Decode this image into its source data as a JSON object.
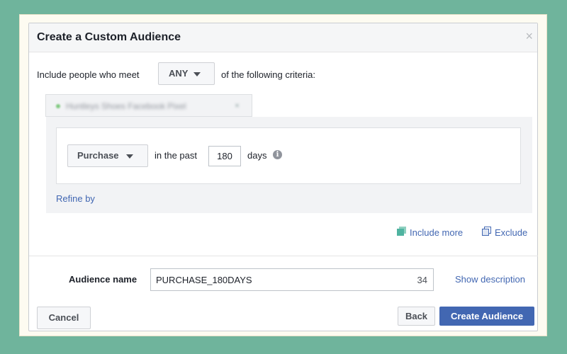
{
  "dialog": {
    "title": "Create a Custom Audience",
    "close_glyph": "×"
  },
  "criteria": {
    "prefix": "Include people who meet",
    "match_value": "ANY",
    "suffix": "of the following criteria:"
  },
  "pixel_chip": {
    "label": "Huntleys Shoes Facebook Pixel",
    "remove_glyph": "×"
  },
  "rule": {
    "event_value": "Purchase",
    "in_the_past_label": "in the past",
    "days_value": "180",
    "days_label": "days",
    "info_glyph": "i",
    "refine_link": "Refine by"
  },
  "actions": {
    "include_more": "Include more",
    "exclude": "Exclude"
  },
  "audience": {
    "name_label": "Audience name",
    "name_value": "PURCHASE_180DAYS",
    "char_count": "34",
    "show_description": "Show description"
  },
  "footer": {
    "cancel": "Cancel",
    "back": "Back",
    "create": "Create Audience"
  },
  "colors": {
    "accent": "#4267b2",
    "link": "#4267b2",
    "include_icon": "#4fb3a0",
    "background": "#6fb49c"
  }
}
